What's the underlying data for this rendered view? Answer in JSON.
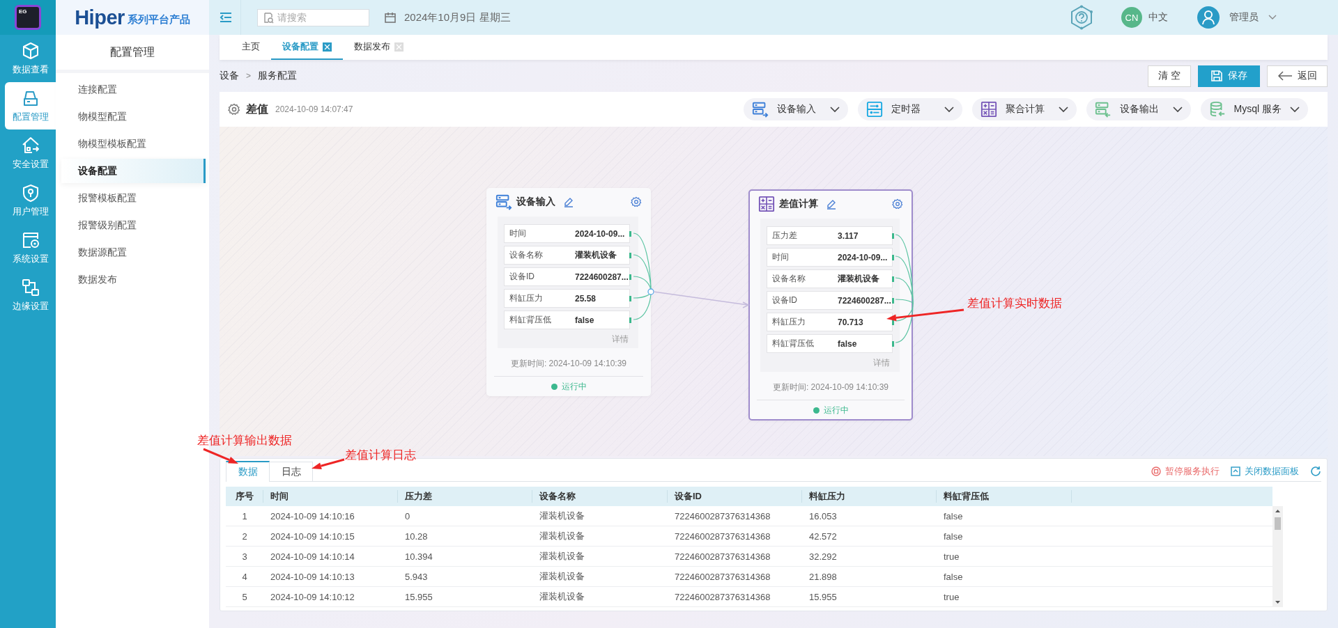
{
  "rail": {
    "logo": "EG",
    "items": [
      {
        "label": "数据查看",
        "selected": false
      },
      {
        "label": "配置管理",
        "selected": true
      },
      {
        "label": "安全设置",
        "selected": false
      },
      {
        "label": "用户管理",
        "selected": false
      },
      {
        "label": "系统设置",
        "selected": false
      },
      {
        "label": "边缘设置",
        "selected": false
      }
    ]
  },
  "brand": {
    "name": "Hiper",
    "tagline": "系列平台产品"
  },
  "sidebar": {
    "title": "配置管理",
    "items": [
      {
        "label": "连接配置",
        "selected": false
      },
      {
        "label": "物模型配置",
        "selected": false
      },
      {
        "label": "物模型模板配置",
        "selected": false
      },
      {
        "label": "设备配置",
        "selected": true
      },
      {
        "label": "报警模板配置",
        "selected": false
      },
      {
        "label": "报警级别配置",
        "selected": false
      },
      {
        "label": "数据源配置",
        "selected": false
      },
      {
        "label": "数据发布",
        "selected": false
      }
    ]
  },
  "topbar": {
    "search": {
      "placeholder": "请搜索"
    },
    "date": "2024年10月9日 星期三",
    "language": {
      "code": "CN",
      "label": "中文"
    },
    "user": {
      "name": "管理员"
    }
  },
  "tabs": [
    {
      "label": "主页",
      "selected": false,
      "closable": false
    },
    {
      "label": "设备配置",
      "selected": true,
      "closable": true
    },
    {
      "label": "数据发布",
      "selected": false,
      "closable": true
    }
  ],
  "breadcrumb": {
    "items": [
      "设备",
      "服务配置"
    ],
    "separator": ">"
  },
  "actions": [
    {
      "label": "清 空",
      "kind": "plain"
    },
    {
      "label": "保存",
      "kind": "save"
    },
    {
      "label": "返回",
      "kind": "back"
    }
  ],
  "service": {
    "name": "差值",
    "time": "2024-10-09 14:07:47"
  },
  "palette": [
    {
      "label": "设备输入",
      "kind": "input"
    },
    {
      "label": "定时器",
      "kind": "timer"
    },
    {
      "label": "聚合计算",
      "kind": "calc"
    },
    {
      "label": "设备输出",
      "kind": "output"
    },
    {
      "label": "Mysql 服务",
      "kind": "db"
    }
  ],
  "nodes": [
    {
      "title": "设备输入",
      "kind": "input",
      "selected": false,
      "fields": [
        {
          "name": "时间",
          "value": "2024-10-09..."
        },
        {
          "name": "设备名称",
          "value": "灌装机设备"
        },
        {
          "name": "设备ID",
          "value": "7224600287..."
        },
        {
          "name": "料缸压力",
          "value": "25.58"
        },
        {
          "name": "料缸背压低",
          "value": "false"
        }
      ],
      "details": "详情",
      "updated": "更新时间: 2024-10-09 14:10:39",
      "status": "运行中"
    },
    {
      "title": "差值计算",
      "kind": "calc",
      "selected": true,
      "fields": [
        {
          "name": "压力差",
          "value": "3.117"
        },
        {
          "name": "时间",
          "value": "2024-10-09..."
        },
        {
          "name": "设备名称",
          "value": "灌装机设备"
        },
        {
          "name": "设备ID",
          "value": "7224600287..."
        },
        {
          "name": "料缸压力",
          "value": "70.713"
        },
        {
          "name": "料缸背压低",
          "value": "false"
        }
      ],
      "details": "详情",
      "updated": "更新时间: 2024-10-09 14:10:39",
      "status": "运行中"
    }
  ],
  "annotations": [
    {
      "text": "差值计算实时数据"
    },
    {
      "text": "差值计算输出数据"
    },
    {
      "text": "差值计算日志"
    }
  ],
  "panel": {
    "tabs": [
      {
        "label": "数据",
        "selected": true
      },
      {
        "label": "日志",
        "selected": false
      }
    ],
    "actions": [
      {
        "label": "暂停服务执行",
        "kind": "pause"
      },
      {
        "label": "关闭数据面板",
        "kind": "close"
      }
    ],
    "table": {
      "columns": [
        "序号",
        "时间",
        "压力差",
        "设备名称",
        "设备ID",
        "料缸压力",
        "料缸背压低"
      ],
      "rows": [
        [
          "1",
          "2024-10-09 14:10:16",
          "0",
          "灌装机设备",
          "7224600287376314368",
          "16.053",
          "false"
        ],
        [
          "2",
          "2024-10-09 14:10:15",
          "10.28",
          "灌装机设备",
          "7224600287376314368",
          "42.572",
          "false"
        ],
        [
          "3",
          "2024-10-09 14:10:14",
          "10.394",
          "灌装机设备",
          "7224600287376314368",
          "32.292",
          "true"
        ],
        [
          "4",
          "2024-10-09 14:10:13",
          "5.943",
          "灌装机设备",
          "7224600287376314368",
          "21.898",
          "false"
        ],
        [
          "5",
          "2024-10-09 14:10:12",
          "15.955",
          "灌装机设备",
          "7224600287376314368",
          "15.955",
          "true"
        ]
      ]
    }
  }
}
